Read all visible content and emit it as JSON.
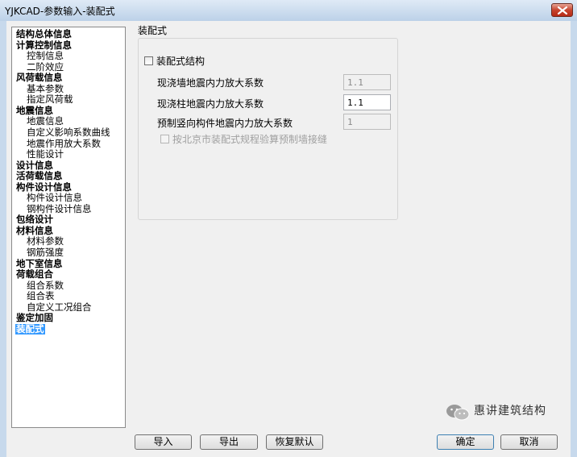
{
  "window": {
    "title": "YJKCAD-参数输入-装配式"
  },
  "tree": {
    "items": [
      {
        "label": "结构总体信息",
        "level": 0
      },
      {
        "label": "计算控制信息",
        "level": 0
      },
      {
        "label": "控制信息",
        "level": 1
      },
      {
        "label": "二阶效应",
        "level": 1
      },
      {
        "label": "风荷载信息",
        "level": 0
      },
      {
        "label": "基本参数",
        "level": 1
      },
      {
        "label": "指定风荷载",
        "level": 1
      },
      {
        "label": "地震信息",
        "level": 0
      },
      {
        "label": "地震信息",
        "level": 1
      },
      {
        "label": "自定义影响系数曲线",
        "level": 1
      },
      {
        "label": "地震作用放大系数",
        "level": 1
      },
      {
        "label": "性能设计",
        "level": 1
      },
      {
        "label": "设计信息",
        "level": 0
      },
      {
        "label": "活荷载信息",
        "level": 0
      },
      {
        "label": "构件设计信息",
        "level": 0
      },
      {
        "label": "构件设计信息",
        "level": 1
      },
      {
        "label": "钢构件设计信息",
        "level": 1
      },
      {
        "label": "包络设计",
        "level": 0
      },
      {
        "label": "材料信息",
        "level": 0
      },
      {
        "label": "材料参数",
        "level": 1
      },
      {
        "label": "钢筋强度",
        "level": 1
      },
      {
        "label": "地下室信息",
        "level": 0
      },
      {
        "label": "荷载组合",
        "level": 0
      },
      {
        "label": "组合系数",
        "level": 1
      },
      {
        "label": "组合表",
        "level": 1
      },
      {
        "label": "自定义工况组合",
        "level": 1
      },
      {
        "label": "鉴定加固",
        "level": 0
      },
      {
        "label": "装配式",
        "level": 0,
        "selected": true
      }
    ]
  },
  "panel": {
    "title": "装配式",
    "checkbox_label": "装配式结构",
    "fields": [
      {
        "label": "现浇墙地震内力放大系数",
        "value": "1.1",
        "enabled": false
      },
      {
        "label": "现浇柱地震内力放大系数",
        "value": "1.1",
        "enabled": true
      },
      {
        "label": "预制竖向构件地震内力放大系数",
        "value": "1",
        "enabled": false
      }
    ],
    "beijing_checkbox_label": "按北京市装配式规程验算预制墙接缝"
  },
  "buttons": {
    "import": "导入",
    "export": "导出",
    "restore": "恢复默认",
    "ok": "确定",
    "cancel": "取消"
  },
  "watermark": {
    "text": "惠讲建筑结构"
  }
}
